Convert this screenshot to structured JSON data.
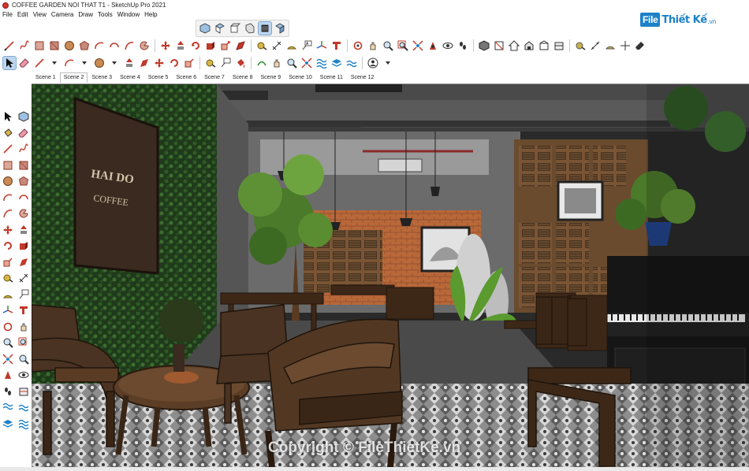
{
  "window": {
    "title": "COFFEE GARDEN NOI THAT T1 - SketchUp Pro 2021"
  },
  "menu": [
    "File",
    "Edit",
    "View",
    "Camera",
    "Draw",
    "Tools",
    "Window",
    "Help"
  ],
  "watermark": {
    "logo_box": "File",
    "logo_text": "Thiết Kế",
    "logo_domain": ".vn",
    "copyright": "Copyright © FileThietKe.vn"
  },
  "scenes": {
    "active_index": 1,
    "tabs": [
      "Scene 1",
      "Scene 2",
      "Scene 3",
      "Scene 4",
      "Scene 5",
      "Scene 6",
      "Scene 7",
      "Scene 8",
      "Scene 9",
      "Scene 10",
      "Scene 11",
      "Scene 12"
    ]
  },
  "viewport": {
    "sign_line1": "HAI DO",
    "sign_line2": "COFFEE"
  },
  "toolbars": {
    "views": [
      "iso-view-icon",
      "top-view-icon",
      "front-view-icon",
      "right-view-icon",
      "back-view-icon",
      "left-view-icon"
    ],
    "drawing": [
      "line-icon",
      "freehand-icon",
      "rectangle-icon",
      "rotated-rectangle-icon",
      "circle-icon",
      "polygon-icon",
      "arc-icon",
      "two-point-arc-icon",
      "three-point-arc-icon",
      "pie-icon"
    ],
    "edit": [
      "move-icon",
      "push-pull-icon",
      "rotate-icon",
      "follow-me-icon",
      "scale-icon",
      "offset-icon",
      "tape-measure-icon",
      "dimension-icon",
      "protractor-icon",
      "text-icon",
      "axes-icon",
      "3d-text-icon",
      "orbit-icon",
      "pan-icon",
      "zoom-icon",
      "zoom-window-icon",
      "zoom-extents-icon",
      "position-camera-icon",
      "look-around-icon",
      "walk-icon"
    ],
    "warehouse": [
      "components-icon",
      "styles-icon",
      "house-icon",
      "warehouse-icon",
      "extension-icon",
      "section-plane-icon",
      "section-display-icon",
      "section-cut-icon",
      "tape-icon",
      "dimension-icon",
      "text-icon",
      "axes-icon",
      "eraser-icon"
    ]
  },
  "colors": {
    "accent": "#1d82c8",
    "active_tool": "#bcd6ee"
  }
}
